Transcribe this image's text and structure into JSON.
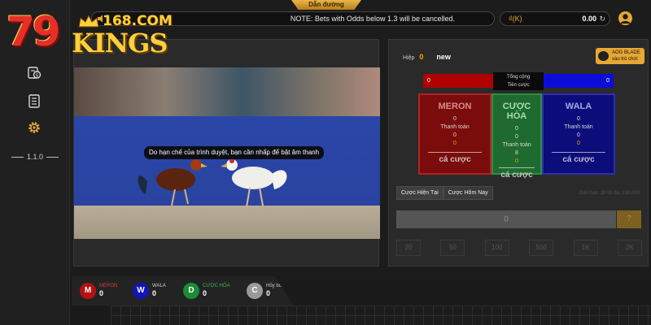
{
  "logo": {
    "number": "79",
    "site": "168.COM",
    "brand": "KINGS"
  },
  "sidebar": {
    "items": [
      {
        "icon": "money-bag-icon"
      },
      {
        "icon": "report-list-icon"
      },
      {
        "icon": "gear-icon"
      }
    ],
    "version": "1.1.0"
  },
  "header": {
    "guide": "Dẫn đường",
    "notice": "NOTE: Bets with Odds below 1.3 will be cancelled.",
    "currency": "₫(K)",
    "balance": "0.00"
  },
  "video": {
    "caption": "Do hạn chế của trình duyệt, bạn cần nhấp để bật âm thanh"
  },
  "bet": {
    "round_label": "Hiệp",
    "round_number": "0",
    "status": "new",
    "provider_line1": "AOG BLADE",
    "provider_line2": "vào trò chơi",
    "total_line1": "Tổng cộng",
    "total_line2": "Tiền cược",
    "total_meron": "0",
    "total_wala": "0",
    "options": [
      {
        "title": "MERON",
        "odds": "0",
        "payout_label": "Thanh toán",
        "payout": "0",
        "my_bet": "0",
        "bet_label": "cá cược"
      },
      {
        "title": "CƯỢC HÒA",
        "odds": "0",
        "odds2": "0",
        "payout_label": "Thanh toán",
        "payout": "8",
        "my_bet": "0",
        "bet_label": "cá cược"
      },
      {
        "title": "WALA",
        "odds": "0",
        "payout_label": "Thanh toán",
        "payout": "0",
        "my_bet": "0",
        "bet_label": "cá cược"
      }
    ],
    "tabs": [
      "Cược Hiện Tại",
      "Cược Hôm Nay"
    ],
    "limits": "Giới hạn: 20 tối đa: 100,000",
    "amount": "0",
    "confirm": "?",
    "chips": [
      "20",
      "50",
      "100",
      "500",
      "1K",
      "2K"
    ]
  },
  "results": [
    {
      "letter": "M",
      "label": "MERON",
      "count": "0",
      "color": "#b31212",
      "label_color": "#d63a3a"
    },
    {
      "letter": "W",
      "label": "WALA",
      "count": "0",
      "color": "#1414b8",
      "label_color": "#cfcfcf"
    },
    {
      "letter": "D",
      "label": "CƯỢC HÒA",
      "count": "0",
      "color": "#1e8a37",
      "label_color": "#39b355"
    },
    {
      "letter": "C",
      "label": "Hủy bỏ",
      "count": "0",
      "color": "#9a9a9a",
      "label_color": "#cfcfcf"
    }
  ]
}
